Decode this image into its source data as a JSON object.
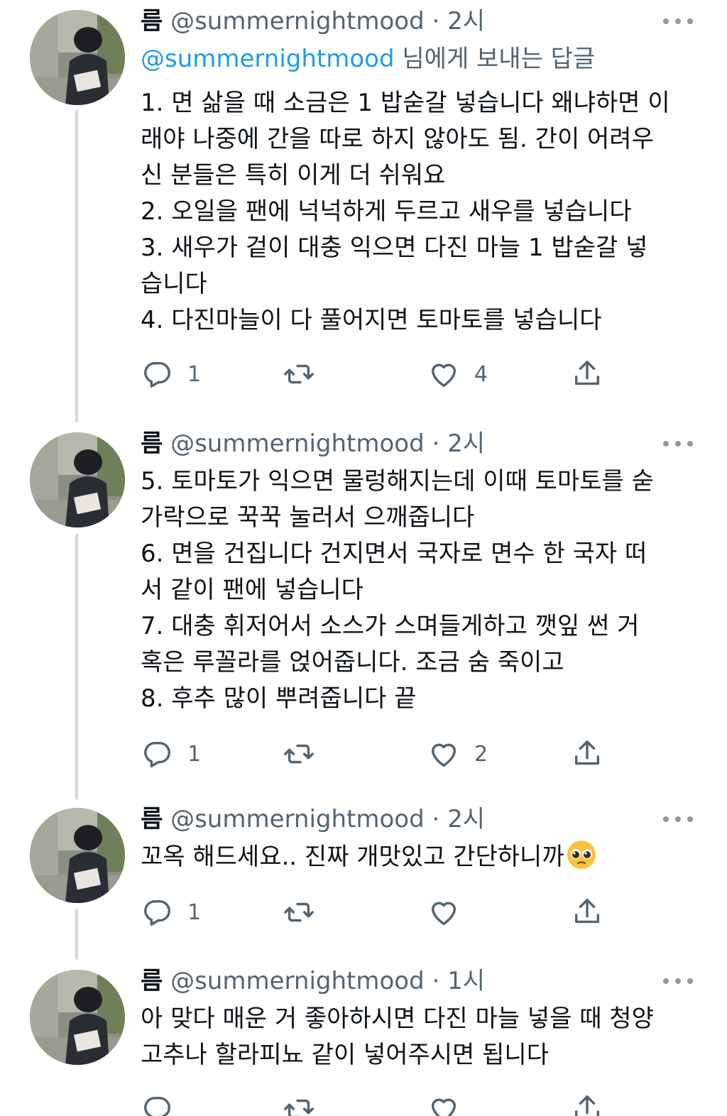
{
  "tweets": [
    {
      "name": "름",
      "handle": "@summernightmood",
      "dot": "·",
      "time": "2시",
      "replying_mention": "@summernightmood",
      "replying_suffix": " 님에게 보내는 답글",
      "lines": [
        "1. 면 삶을 때 소금은 1 밥숟갈 넣습니다 왜냐하면 이",
        "래야 나중에 간을 따로 하지 않아도 됨. 간이 어려우",
        "신 분들은 특히 이게 더 쉬워요",
        "2. 오일을 팬에 넉넉하게 두르고 새우를 넣습니다",
        "3. 새우가 겉이 대충 익으면 다진 마늘 1 밥숟갈 넣",
        "습니다",
        "4. 다진마늘이 다 풀어지면 토마토를 넣습니다"
      ],
      "reply_count": "1",
      "retweet_count": "",
      "like_count": "4"
    },
    {
      "name": "름",
      "handle": "@summernightmood",
      "dot": "·",
      "time": "2시",
      "lines": [
        "5. 토마토가 익으면 물렁해지는데 이때 토마토를 숟",
        "가락으로 꾹꾹 눌러서 으깨줍니다",
        "6. 면을 건집니다 건지면서 국자로 면수 한 국자 떠",
        "서 같이 팬에 넣습니다",
        "7. 대충 휘저어서 소스가 스며들게하고 깻잎 썬 거",
        "혹은 루꼴라를 얹어줍니다. 조금 숨 죽이고",
        "8. 후추 많이 뿌려줍니다 끝"
      ],
      "reply_count": "1",
      "retweet_count": "",
      "like_count": "2"
    },
    {
      "name": "름",
      "handle": "@summernightmood",
      "dot": "·",
      "time": "2시",
      "lines": [
        "꼬옥 해드세요.. 진짜 개맛있고 간단하니까"
      ],
      "emoji": "pleading-face-emoji",
      "reply_count": "1",
      "retweet_count": "",
      "like_count": ""
    },
    {
      "name": "름",
      "handle": "@summernightmood",
      "dot": "·",
      "time": "1시",
      "lines": [
        "아 맞다 매운 거 좋아하시면 다진 마늘 넣을 때 청양",
        "고추나 할라피뇨 같이 넣어주시면 됩니다"
      ],
      "reply_count": "",
      "retweet_count": "",
      "like_count": ""
    }
  ],
  "icons": {
    "reply": "reply-icon",
    "retweet": "retweet-icon",
    "like": "heart-icon",
    "share": "share-icon",
    "more": "more-dots-icon"
  },
  "colors": {
    "text": "#0f1419",
    "secondary": "#536471",
    "link": "#1d9bf0",
    "thread_line": "#cfd9de",
    "icon": "#536471"
  }
}
